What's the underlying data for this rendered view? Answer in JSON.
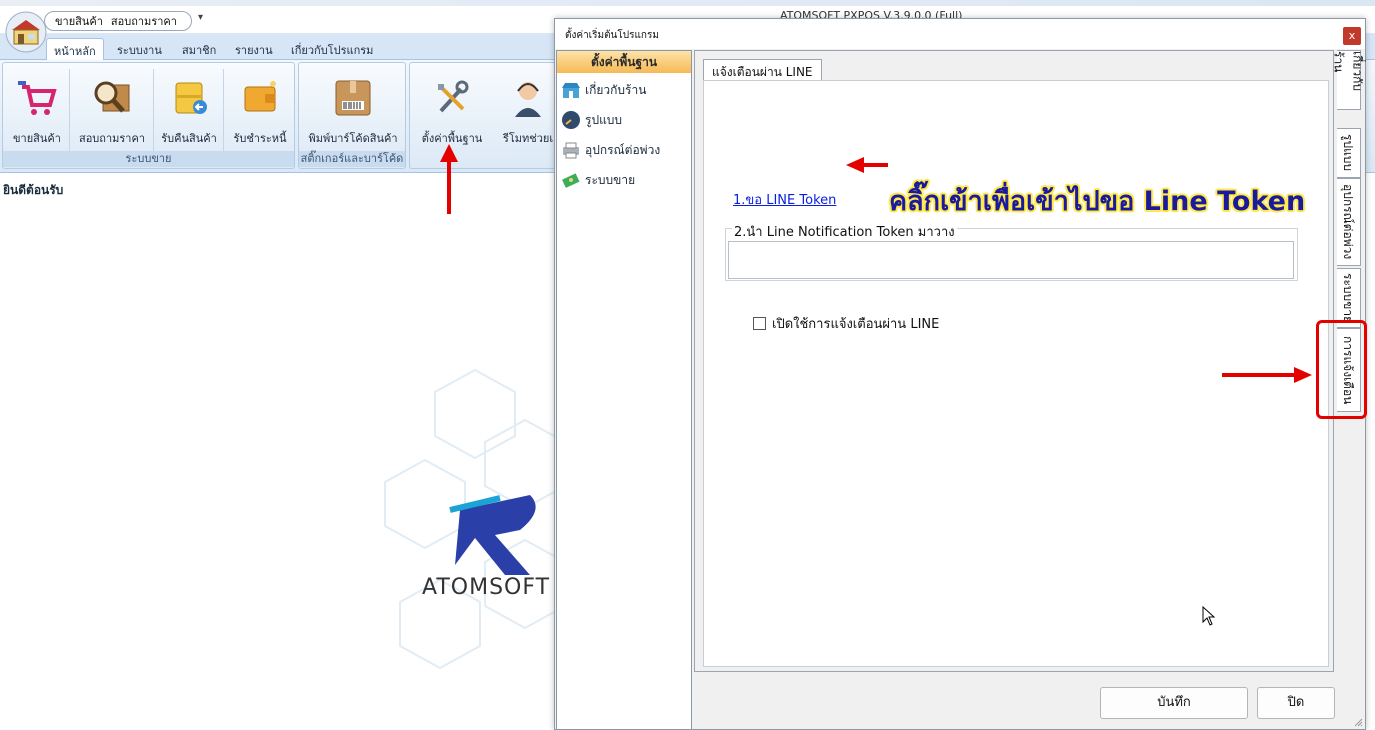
{
  "app": {
    "title": "ATOMSOFT PXPOS V.3.9.0.0 (Full)",
    "quick_access": [
      "ขายสินค้า",
      "สอบถามราคา"
    ],
    "quick_access_arrow": "▾",
    "tabs": [
      "หน้าหลัก",
      "ระบบงาน",
      "สมาชิก",
      "รายงาน",
      "เกี่ยวกับโปรแกรม"
    ],
    "groups": [
      {
        "label": "ระบบขาย",
        "buttons": [
          "ขายสินค้า",
          "สอบถามราคา",
          "รับคืนสินค้า",
          "รับชำระหนี้"
        ]
      },
      {
        "label": "สติ๊กเกอร์และบาร์โค้ด",
        "buttons": [
          "พิมพ์บาร์โค้ดสินค้า"
        ]
      },
      {
        "label": "",
        "buttons": [
          "ตั้งค่าพื้นฐาน",
          "รีโมทช่วยเ"
        ]
      }
    ],
    "welcome": "ยินดีต้อนรับ",
    "brand_text": "ATOMSOFT"
  },
  "dialog": {
    "title": "ตั้งค่าเริ่มต้นโปรแกรม",
    "close_label": "x",
    "nav_header": "ตั้งค่าพื้นฐาน",
    "nav_items": [
      "เกี่ยวกับร้าน",
      "รูปแบบ",
      "อุปกรณ์ต่อพ่วง",
      "ระบบขาย"
    ],
    "page_tab": "แจ้งเตือนผ่าน LINE",
    "link_text": "1.ขอ LINE Token",
    "token_legend": "2.นำ Line Notification Token มาวาง",
    "token_value": "",
    "checkbox_label": "เปิดใช้การแจ้งเตือนผ่าน LINE",
    "vertical_tabs": [
      "เกี่ยวกับร้าน",
      "รูปแบบ",
      "อุปกรณ์ต่อพ่วง",
      "ระบบขาย",
      "การแจ้งเตือน"
    ],
    "save_label": "บันทึก",
    "close_button_label": "ปิด"
  },
  "annotation": {
    "text": "คลิ๊กเข้าเพื่อเข้าไปขอ Line Token",
    "color": "#e50000"
  }
}
